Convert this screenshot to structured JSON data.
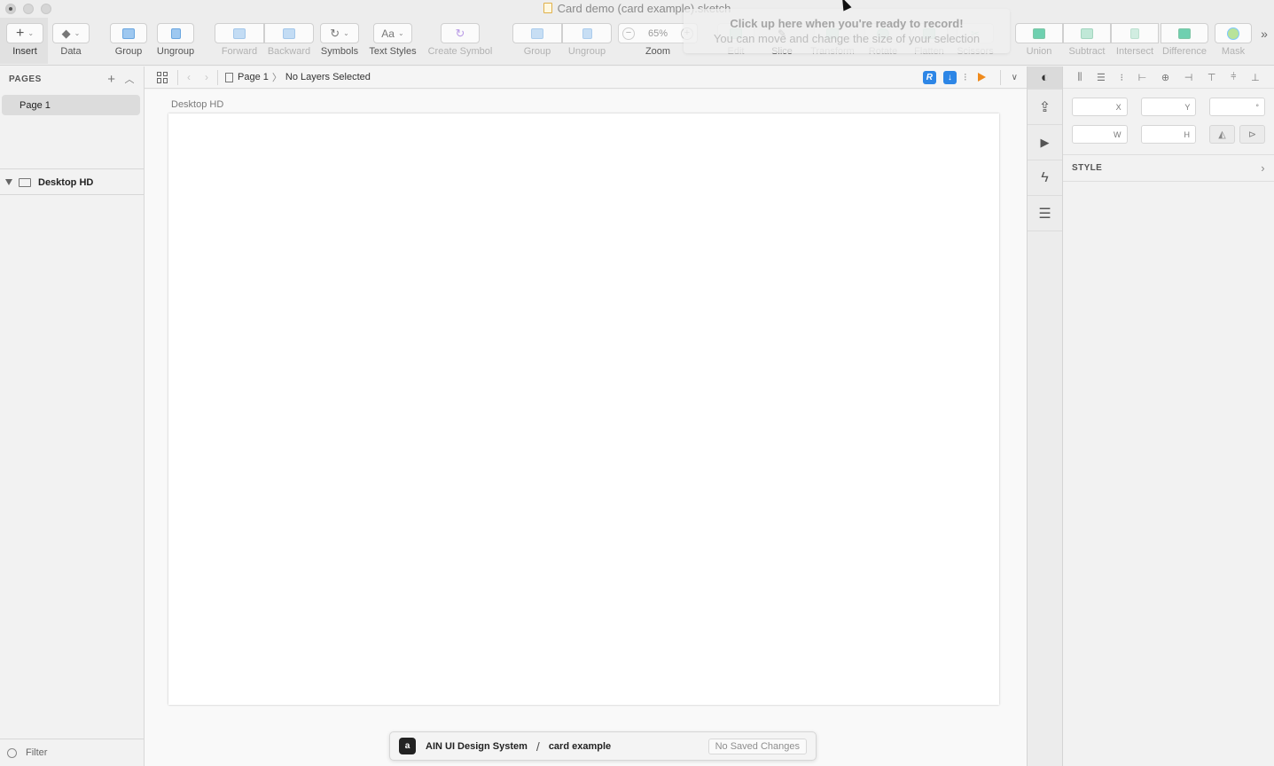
{
  "window": {
    "title": "Card demo (card example).sketch"
  },
  "toolbar": {
    "insert": "Insert",
    "data": "Data",
    "group": "Group",
    "ungroup": "Ungroup",
    "forward": "Forward",
    "backward": "Backward",
    "symbols": "Symbols",
    "text_styles": "Text Styles",
    "text_styles_glyph": "Aa",
    "create_symbol": "Create Symbol",
    "group2": "Group",
    "ungroup2": "Ungroup",
    "zoom": "Zoom",
    "zoom_value": "65%",
    "edit": "Edit",
    "slice": "Slice",
    "transform": "Transform",
    "rotate": "Rotate",
    "flatten": "Flatten",
    "scissors": "Scissors",
    "union": "Union",
    "subtract": "Subtract",
    "intersect": "Intersect",
    "difference": "Difference",
    "mask": "Mask"
  },
  "record_tip": {
    "line1": "Click up here when you're ready to record!",
    "line2": "You can move and change the size of your selection"
  },
  "pages_panel": {
    "header": "PAGES",
    "pages": [
      "Page 1"
    ],
    "layers": [
      "Desktop HD"
    ],
    "filter": "Filter"
  },
  "breadcrumb": {
    "page": "Page 1",
    "status": "No Layers Selected"
  },
  "canvas": {
    "artboard_label": "Desktop HD"
  },
  "cloud_bar": {
    "library": "AIN UI Design System",
    "separator": "/",
    "document": "card example",
    "saved_status": "No Saved Changes"
  },
  "inspector": {
    "x_label": "X",
    "y_label": "Y",
    "rotation_label": "°",
    "w_label": "W",
    "h_label": "H",
    "style_header": "STYLE"
  },
  "icons": [
    "plus-icon",
    "layers-icon",
    "group-icon",
    "ungroup-icon",
    "forward-icon",
    "backward-icon",
    "symbols-icon",
    "create-symbol-icon",
    "zoom-out-icon",
    "zoom-in-icon",
    "union-icon",
    "subtract-icon",
    "intersect-icon",
    "difference-icon",
    "mask-icon",
    "more-icon",
    "add-page-icon",
    "collapse-icon",
    "grid-icon",
    "back-icon",
    "forward-nav-icon",
    "page-icon",
    "plugin-icon",
    "download-icon",
    "play-icon",
    "chevron-down-icon",
    "export-icon",
    "prototype-play-icon",
    "lightning-icon",
    "list-icon",
    "monitor-icon",
    "filter-icon",
    "chevron-right-icon"
  ],
  "colors": {
    "accent_blue": "#2d86e6",
    "play_orange": "#ef8a1c"
  }
}
